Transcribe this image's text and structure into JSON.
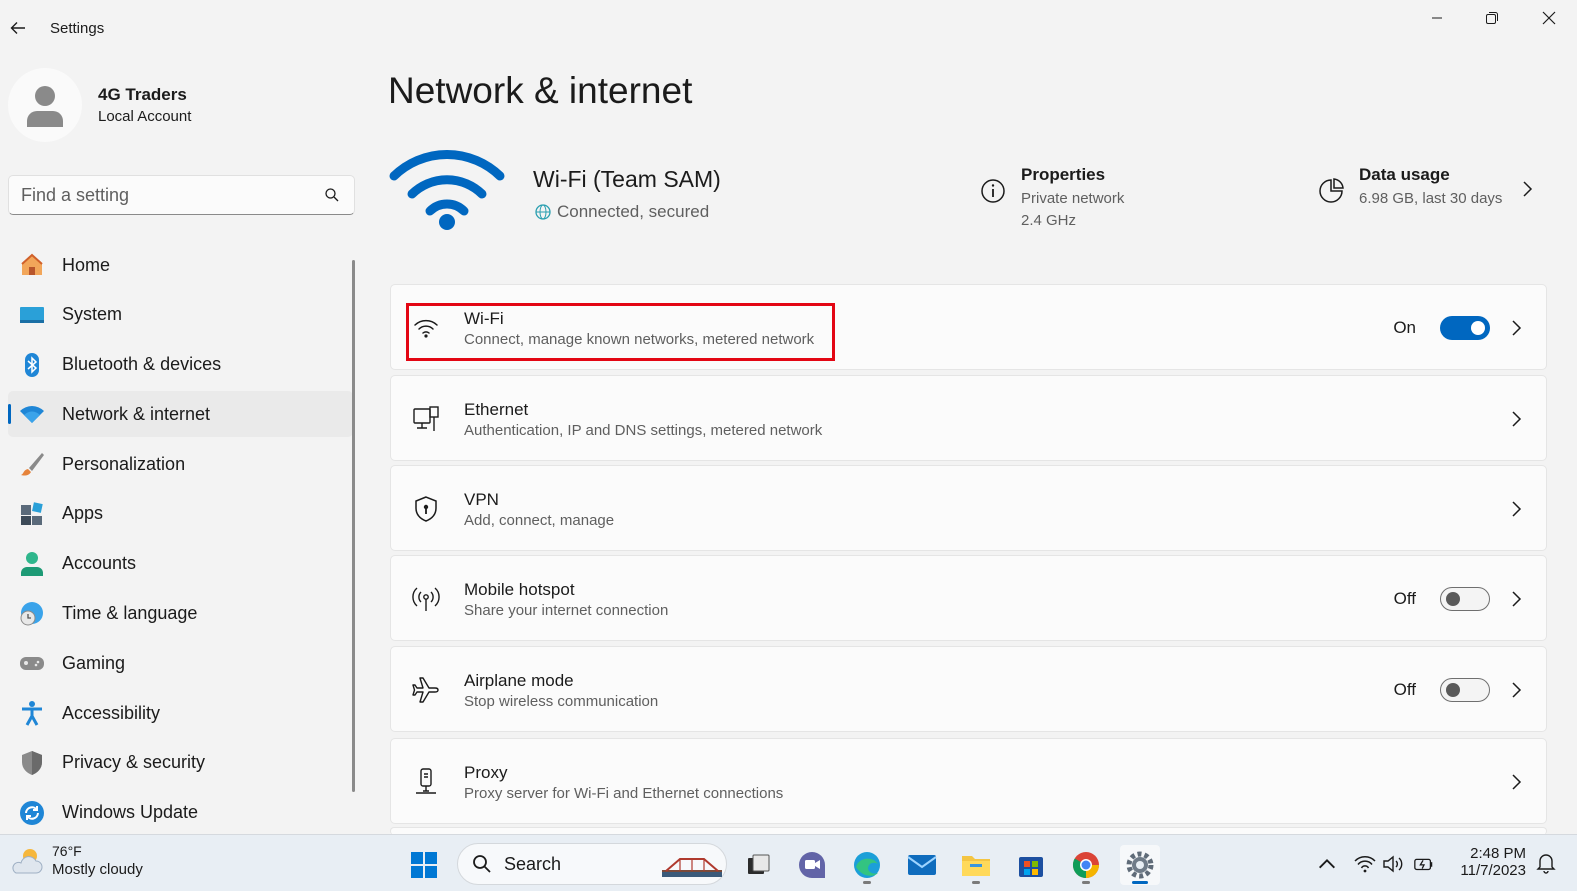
{
  "window": {
    "title": "Settings"
  },
  "profile": {
    "name": "4G Traders",
    "account_type": "Local Account"
  },
  "search": {
    "placeholder": "Find a setting"
  },
  "nav": {
    "items": [
      {
        "label": "Home",
        "icon": "home-icon"
      },
      {
        "label": "System",
        "icon": "system-icon"
      },
      {
        "label": "Bluetooth & devices",
        "icon": "bluetooth-icon"
      },
      {
        "label": "Network & internet",
        "icon": "network-icon",
        "active": true
      },
      {
        "label": "Personalization",
        "icon": "brush-icon"
      },
      {
        "label": "Apps",
        "icon": "apps-icon"
      },
      {
        "label": "Accounts",
        "icon": "accounts-icon"
      },
      {
        "label": "Time & language",
        "icon": "globe-clock-icon"
      },
      {
        "label": "Gaming",
        "icon": "gamepad-icon"
      },
      {
        "label": "Accessibility",
        "icon": "accessibility-icon"
      },
      {
        "label": "Privacy & security",
        "icon": "shield-icon"
      },
      {
        "label": "Windows Update",
        "icon": "update-icon"
      }
    ]
  },
  "main": {
    "title": "Network & internet",
    "connection": {
      "name": "Wi-Fi (Team SAM)",
      "status": "Connected, secured"
    },
    "properties": {
      "title": "Properties",
      "line1": "Private network",
      "line2": "2.4 GHz"
    },
    "data_usage": {
      "title": "Data usage",
      "line1": "6.98 GB, last 30 days"
    },
    "cards": [
      {
        "title": "Wi-Fi",
        "desc": "Connect, manage known networks, metered network",
        "toggle": "On"
      },
      {
        "title": "Ethernet",
        "desc": "Authentication, IP and DNS settings, metered network"
      },
      {
        "title": "VPN",
        "desc": "Add, connect, manage"
      },
      {
        "title": "Mobile hotspot",
        "desc": "Share your internet connection",
        "toggle": "Off"
      },
      {
        "title": "Airplane mode",
        "desc": "Stop wireless communication",
        "toggle": "Off"
      },
      {
        "title": "Proxy",
        "desc": "Proxy server for Wi-Fi and Ethernet connections"
      }
    ]
  },
  "taskbar": {
    "weather": {
      "temp": "76°F",
      "condition": "Mostly cloudy"
    },
    "search_label": "Search",
    "clock": {
      "time": "2:48 PM",
      "date": "11/7/2023"
    }
  },
  "colors": {
    "accent": "#0067c0",
    "highlight": "#e30613"
  }
}
